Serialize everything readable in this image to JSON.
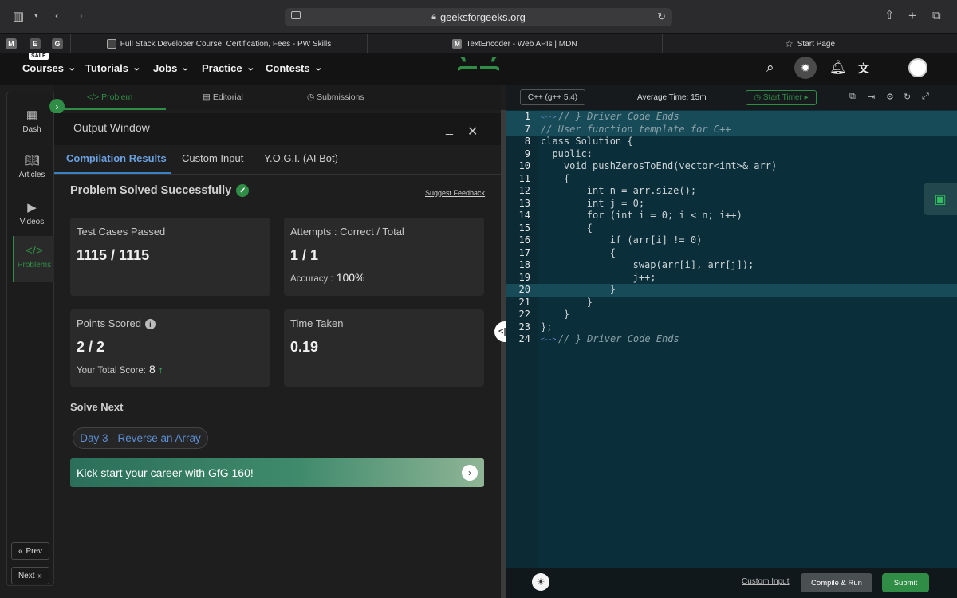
{
  "browser": {
    "url": "geeksforgeeks.org",
    "pinned_tabs": [
      "M",
      "E",
      "G"
    ],
    "tabs": [
      {
        "favicon": "pw-skills-favicon",
        "title": "Full Stack Developer Course, Certification, Fees - PW Skills"
      },
      {
        "favicon": "mdn-favicon",
        "favicon_letter": "M",
        "title": "TextEncoder - Web APIs | MDN"
      },
      {
        "favicon": "star-icon",
        "title": "Start Page"
      }
    ]
  },
  "navbar": {
    "sale_badge": "SALE",
    "items": [
      "Courses",
      "Tutorials",
      "Jobs",
      "Practice",
      "Contests"
    ],
    "logo": "GfG logo",
    "accent": "#2f8d46"
  },
  "rail": {
    "items": [
      {
        "label": "Dash",
        "icon": "dashboard-icon"
      },
      {
        "label": "Articles",
        "icon": "book-icon"
      },
      {
        "label": "Videos",
        "icon": "video-icon"
      },
      {
        "label": "Problems",
        "icon": "code-icon"
      }
    ],
    "prev": "Prev",
    "next": "Next"
  },
  "problem_tabs": [
    {
      "label": "Problem",
      "icon": "code-icon"
    },
    {
      "label": "Editorial",
      "icon": "document-icon"
    },
    {
      "label": "Submissions",
      "icon": "clock-icon"
    }
  ],
  "output": {
    "title": "Output Window",
    "tabs": [
      "Compilation Results",
      "Custom Input",
      "Y.O.G.I. (AI Bot)"
    ],
    "status": "Problem Solved Successfully",
    "feedback": "Suggest Feedback",
    "test_cases": {
      "label": "Test Cases Passed",
      "value": "1115 / 1115"
    },
    "attempts": {
      "label": "Attempts : Correct / Total",
      "value": "1 / 1",
      "accuracy_label": "Accuracy :",
      "accuracy": "100%"
    },
    "points": {
      "label": "Points Scored",
      "value": "2 / 2",
      "total_label": "Your Total Score:",
      "total": "8"
    },
    "time": {
      "label": "Time Taken",
      "value": "0.19"
    },
    "solve_next_label": "Solve Next",
    "next_problem": "Day 3 - Reverse an Array",
    "banner": "Kick start your career with GfG 160!"
  },
  "editor": {
    "language": "C++ (g++ 5.4)",
    "avg_time": "Average Time: 15m",
    "timer": "Start Timer",
    "fold_marker": "<-->",
    "lines": [
      {
        "n": "1",
        "text": "// } Driver Code Ends"
      },
      {
        "n": "7",
        "text": "// User function template for C++"
      },
      {
        "n": "8",
        "text": "class Solution {"
      },
      {
        "n": "9",
        "text": "  public:"
      },
      {
        "n": "10",
        "text": "    void pushZerosToEnd(vector<int>& arr)"
      },
      {
        "n": "11",
        "text": "    {"
      },
      {
        "n": "12",
        "text": "        int n = arr.size();"
      },
      {
        "n": "13",
        "text": "        int j = 0;"
      },
      {
        "n": "14",
        "text": "        for (int i = 0; i < n; i++)"
      },
      {
        "n": "15",
        "text": "        {"
      },
      {
        "n": "16",
        "text": "            if (arr[i] != 0)"
      },
      {
        "n": "17",
        "text": "            {"
      },
      {
        "n": "18",
        "text": "                swap(arr[i], arr[j]);"
      },
      {
        "n": "19",
        "text": "                j++;"
      },
      {
        "n": "20",
        "text": "            }"
      },
      {
        "n": "21",
        "text": "        }"
      },
      {
        "n": "22",
        "text": "    }"
      },
      {
        "n": "23",
        "text": "};"
      },
      {
        "n": "24",
        "text": "// } Driver Code Ends"
      }
    ],
    "custom_input": "Custom Input",
    "compile": "Compile & Run",
    "submit": "Submit"
  }
}
